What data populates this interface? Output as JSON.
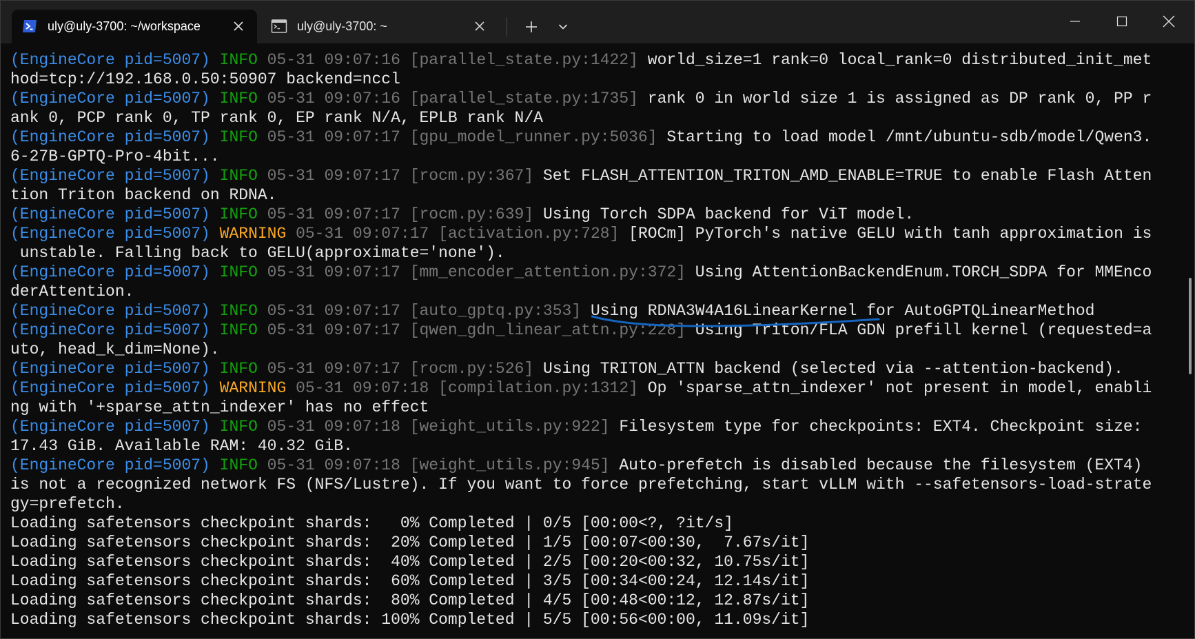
{
  "tabs": [
    {
      "title": "uly@uly-3700: ~/workspace",
      "icon": "powershell-icon",
      "active": true
    },
    {
      "title": "uly@uly-3700: ~",
      "icon": "terminal-icon",
      "active": false
    }
  ],
  "titlebar": {
    "new_tab_icon": "plus-icon",
    "dropdown_icon": "chevron-down-icon",
    "window_controls": [
      "minimize-icon",
      "maximize-icon",
      "close-icon"
    ]
  },
  "colors": {
    "background": "#0c0c0c",
    "titlebar": "#1f1f1f",
    "enginecore": "#3b8eea",
    "info": "#13a10e",
    "warning": "#f9a825",
    "meta": "#767676",
    "text": "#e6e6e6",
    "annotation": "#1565c0"
  },
  "terminal": {
    "lines": [
      [
        {
          "c": "ec",
          "t": "(EngineCore pid=5007) "
        },
        {
          "c": "info",
          "t": "INFO "
        },
        {
          "c": "gray",
          "t": "05-31 09:07:16 [parallel_state.py:1422] "
        },
        {
          "c": "msg",
          "t": "world_size=1 rank=0 local_rank=0 distributed_init_met"
        }
      ],
      [
        {
          "c": "msg",
          "t": "hod=tcp://192.168.0.50:50907 backend=nccl"
        }
      ],
      [
        {
          "c": "ec",
          "t": "(EngineCore pid=5007) "
        },
        {
          "c": "info",
          "t": "INFO "
        },
        {
          "c": "gray",
          "t": "05-31 09:07:16 [parallel_state.py:1735] "
        },
        {
          "c": "msg",
          "t": "rank 0 in world size 1 is assigned as DP rank 0, PP r"
        }
      ],
      [
        {
          "c": "msg",
          "t": "ank 0, PCP rank 0, TP rank 0, EP rank N/A, EPLB rank N/A"
        }
      ],
      [
        {
          "c": "ec",
          "t": "(EngineCore pid=5007) "
        },
        {
          "c": "info",
          "t": "INFO "
        },
        {
          "c": "gray",
          "t": "05-31 09:07:17 [gpu_model_runner.py:5036] "
        },
        {
          "c": "msg",
          "t": "Starting to load model /mnt/ubuntu-sdb/model/Qwen3."
        }
      ],
      [
        {
          "c": "msg",
          "t": "6-27B-GPTQ-Pro-4bit..."
        }
      ],
      [
        {
          "c": "ec",
          "t": "(EngineCore pid=5007) "
        },
        {
          "c": "info",
          "t": "INFO "
        },
        {
          "c": "gray",
          "t": "05-31 09:07:17 [rocm.py:367] "
        },
        {
          "c": "msg",
          "t": "Set FLASH_ATTENTION_TRITON_AMD_ENABLE=TRUE to enable Flash Atten"
        }
      ],
      [
        {
          "c": "msg",
          "t": "tion Triton backend on RDNA."
        }
      ],
      [
        {
          "c": "ec",
          "t": "(EngineCore pid=5007) "
        },
        {
          "c": "info",
          "t": "INFO "
        },
        {
          "c": "gray",
          "t": "05-31 09:07:17 [rocm.py:639] "
        },
        {
          "c": "msg",
          "t": "Using Torch SDPA backend for ViT model."
        }
      ],
      [
        {
          "c": "ec",
          "t": "(EngineCore pid=5007) "
        },
        {
          "c": "warn",
          "t": "WARNING "
        },
        {
          "c": "gray",
          "t": "05-31 09:07:17 [activation.py:728] "
        },
        {
          "c": "msg",
          "t": "[ROCm] PyTorch's native GELU with tanh approximation is"
        }
      ],
      [
        {
          "c": "msg",
          "t": " unstable. Falling back to GELU(approximate='none')."
        }
      ],
      [
        {
          "c": "ec",
          "t": "(EngineCore pid=5007) "
        },
        {
          "c": "info",
          "t": "INFO "
        },
        {
          "c": "gray",
          "t": "05-31 09:07:17 [mm_encoder_attention.py:372] "
        },
        {
          "c": "msg",
          "t": "Using AttentionBackendEnum.TORCH_SDPA for MMEnco"
        }
      ],
      [
        {
          "c": "msg",
          "t": "derAttention."
        }
      ],
      [
        {
          "c": "ec",
          "t": "(EngineCore pid=5007) "
        },
        {
          "c": "info",
          "t": "INFO "
        },
        {
          "c": "gray",
          "t": "05-31 09:07:17 [auto_gptq.py:353] "
        },
        {
          "c": "msg",
          "t": "Using RDNA3W4A16LinearKernel for AutoGPTQLinearMethod"
        }
      ],
      [
        {
          "c": "ec",
          "t": "(EngineCore pid=5007) "
        },
        {
          "c": "info",
          "t": "INFO "
        },
        {
          "c": "gray",
          "t": "05-31 09:07:17 [qwen_gdn_linear_attn.py:228] "
        },
        {
          "c": "msg",
          "t": "Using Triton/FLA GDN prefill kernel (requested=a"
        }
      ],
      [
        {
          "c": "msg",
          "t": "uto, head_k_dim=None)."
        }
      ],
      [
        {
          "c": "ec",
          "t": "(EngineCore pid=5007) "
        },
        {
          "c": "info",
          "t": "INFO "
        },
        {
          "c": "gray",
          "t": "05-31 09:07:17 [rocm.py:526] "
        },
        {
          "c": "msg",
          "t": "Using TRITON_ATTN backend (selected via --attention-backend)."
        }
      ],
      [
        {
          "c": "ec",
          "t": "(EngineCore pid=5007) "
        },
        {
          "c": "warn",
          "t": "WARNING "
        },
        {
          "c": "gray",
          "t": "05-31 09:07:18 [compilation.py:1312] "
        },
        {
          "c": "msg",
          "t": "Op 'sparse_attn_indexer' not present in model, enabli"
        }
      ],
      [
        {
          "c": "msg",
          "t": "ng with '+sparse_attn_indexer' has no effect"
        }
      ],
      [
        {
          "c": "ec",
          "t": "(EngineCore pid=5007) "
        },
        {
          "c": "info",
          "t": "INFO "
        },
        {
          "c": "gray",
          "t": "05-31 09:07:18 [weight_utils.py:922] "
        },
        {
          "c": "msg",
          "t": "Filesystem type for checkpoints: EXT4. Checkpoint size:"
        }
      ],
      [
        {
          "c": "msg",
          "t": "17.43 GiB. Available RAM: 40.32 GiB."
        }
      ],
      [
        {
          "c": "ec",
          "t": "(EngineCore pid=5007) "
        },
        {
          "c": "info",
          "t": "INFO "
        },
        {
          "c": "gray",
          "t": "05-31 09:07:18 [weight_utils.py:945] "
        },
        {
          "c": "msg",
          "t": "Auto-prefetch is disabled because the filesystem (EXT4)"
        }
      ],
      [
        {
          "c": "msg",
          "t": "is not a recognized network FS (NFS/Lustre). If you want to force prefetching, start vLLM with --safetensors-load-strate"
        }
      ],
      [
        {
          "c": "msg",
          "t": "gy=prefetch."
        }
      ],
      [
        {
          "c": "msg",
          "t": "Loading safetensors checkpoint shards:   0% Completed | 0/5 [00:00<?, ?it/s]"
        }
      ],
      [
        {
          "c": "msg",
          "t": "Loading safetensors checkpoint shards:  20% Completed | 1/5 [00:07<00:30,  7.67s/it]"
        }
      ],
      [
        {
          "c": "msg",
          "t": "Loading safetensors checkpoint shards:  40% Completed | 2/5 [00:20<00:32, 10.75s/it]"
        }
      ],
      [
        {
          "c": "msg",
          "t": "Loading safetensors checkpoint shards:  60% Completed | 3/5 [00:34<00:24, 12.14s/it]"
        }
      ],
      [
        {
          "c": "msg",
          "t": "Loading safetensors checkpoint shards:  80% Completed | 4/5 [00:48<00:12, 12.87s/it]"
        }
      ],
      [
        {
          "c": "msg",
          "t": "Loading safetensors checkpoint shards: 100% Completed | 5/5 [00:56<00:00, 11.09s/it]"
        }
      ]
    ]
  }
}
